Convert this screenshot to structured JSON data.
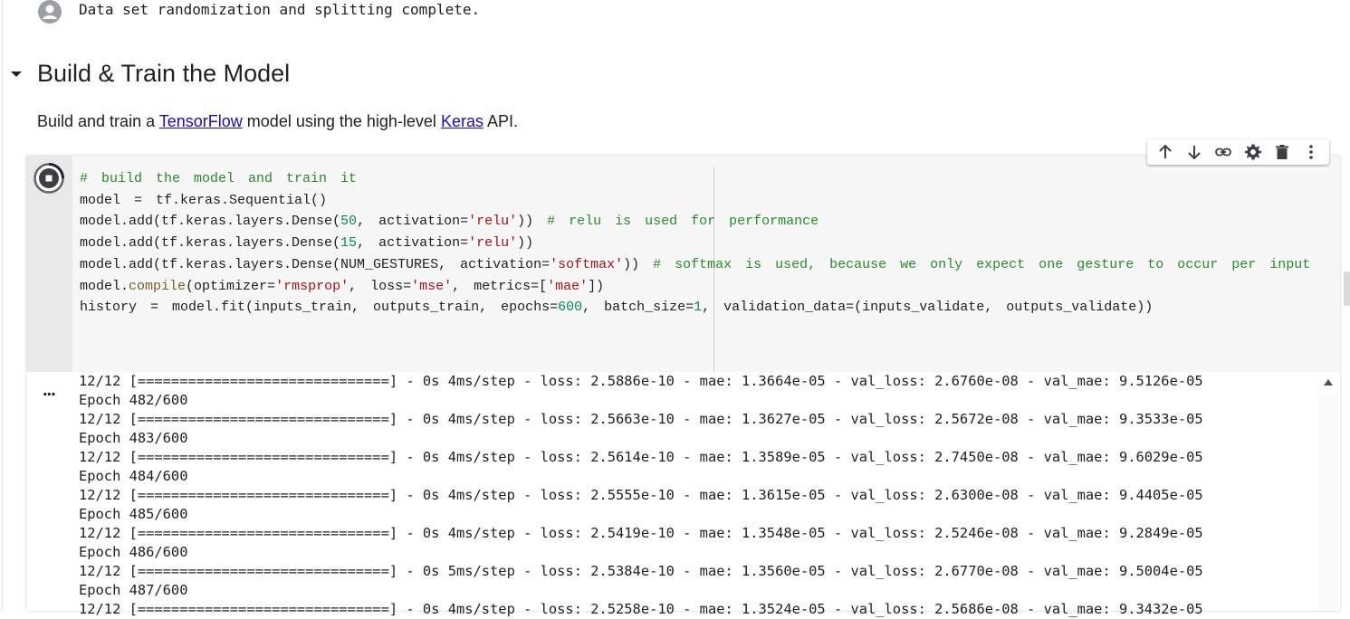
{
  "previous_output": {
    "text": "Data set randomization and splitting complete."
  },
  "section": {
    "title": "Build & Train the Model",
    "description_prefix": "Build and train a ",
    "link_tensorflow": "TensorFlow",
    "description_middle": " model using the high-level ",
    "link_keras": "Keras",
    "description_suffix": " API."
  },
  "toolbar": {
    "buttons": [
      "move-up-icon",
      "move-down-icon",
      "link-icon",
      "gear-icon",
      "trash-icon",
      "more-vert-icon"
    ]
  },
  "code": {
    "lines": [
      [
        {
          "t": "# build the model and train it",
          "c": "cm"
        }
      ],
      [
        {
          "t": "model = tf.keras.Sequential()"
        }
      ],
      [
        {
          "t": "model.add(tf.keras.layers.Dense("
        },
        {
          "t": "50",
          "c": "num"
        },
        {
          "t": ", activation="
        },
        {
          "t": "'relu'",
          "c": "str"
        },
        {
          "t": ")) "
        },
        {
          "t": "# relu is used for performance",
          "c": "cm"
        }
      ],
      [
        {
          "t": "model.add(tf.keras.layers.Dense("
        },
        {
          "t": "15",
          "c": "num"
        },
        {
          "t": ", activation="
        },
        {
          "t": "'relu'",
          "c": "str"
        },
        {
          "t": "))"
        }
      ],
      [
        {
          "t": "model.add(tf.keras.layers.Dense(NUM_GESTURES, activation="
        },
        {
          "t": "'softmax'",
          "c": "str"
        },
        {
          "t": ")) "
        },
        {
          "t": "# softmax is used, because we only expect one gesture to occur per input",
          "c": "cm"
        }
      ],
      [
        {
          "t": "model."
        },
        {
          "t": "compile",
          "c": "fn"
        },
        {
          "t": "(optimizer="
        },
        {
          "t": "'rmsprop'",
          "c": "str"
        },
        {
          "t": ", loss="
        },
        {
          "t": "'mse'",
          "c": "str"
        },
        {
          "t": ", metrics=["
        },
        {
          "t": "'mae'",
          "c": "str"
        },
        {
          "t": "])"
        }
      ],
      [
        {
          "t": "history = model.fit(inputs_train, outputs_train, epochs="
        },
        {
          "t": "600",
          "c": "num"
        },
        {
          "t": ", batch_size="
        },
        {
          "t": "1",
          "c": "num"
        },
        {
          "t": ", validation_data=(inputs_validate, outputs_validate))"
        }
      ]
    ]
  },
  "output": {
    "dots": "...",
    "lines": [
      "12/12 [==============================] - 0s 4ms/step - loss: 2.5886e-10 - mae: 1.3664e-05 - val_loss: 2.6760e-08 - val_mae: 9.5126e-05",
      "Epoch 482/600",
      "12/12 [==============================] - 0s 4ms/step - loss: 2.5663e-10 - mae: 1.3627e-05 - val_loss: 2.5672e-08 - val_mae: 9.3533e-05",
      "Epoch 483/600",
      "12/12 [==============================] - 0s 4ms/step - loss: 2.5614e-10 - mae: 1.3589e-05 - val_loss: 2.7450e-08 - val_mae: 9.6029e-05",
      "Epoch 484/600",
      "12/12 [==============================] - 0s 4ms/step - loss: 2.5555e-10 - mae: 1.3615e-05 - val_loss: 2.6300e-08 - val_mae: 9.4405e-05",
      "Epoch 485/600",
      "12/12 [==============================] - 0s 4ms/step - loss: 2.5419e-10 - mae: 1.3548e-05 - val_loss: 2.5246e-08 - val_mae: 9.2849e-05",
      "Epoch 486/600",
      "12/12 [==============================] - 0s 5ms/step - loss: 2.5384e-10 - mae: 1.3560e-05 - val_loss: 2.6770e-08 - val_mae: 9.5004e-05",
      "Epoch 487/600",
      "12/12 [==============================] - 0s 4ms/step - loss: 2.5258e-10 - mae: 1.3524e-05 - val_loss: 2.5686e-08 - val_mae: 9.3432e-05"
    ]
  },
  "colors": {
    "link": "#1a0dab",
    "comment": "#2a8a2a",
    "string": "#a31515",
    "number": "#09885a"
  }
}
